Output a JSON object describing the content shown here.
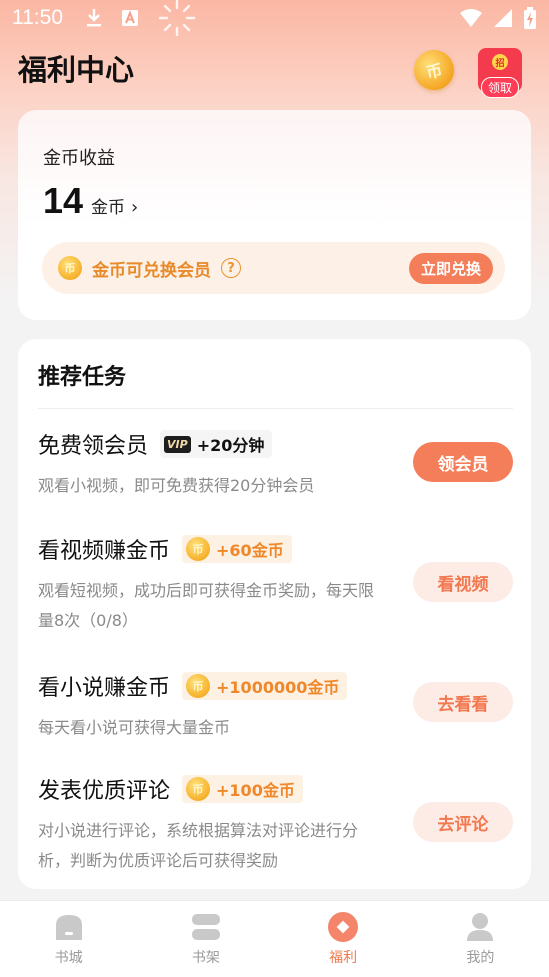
{
  "status_bar": {
    "time": "11:50",
    "left_icons": [
      "download-icon",
      "font-a-icon",
      "spinner-icon"
    ],
    "right_icons": [
      "wifi-icon",
      "signal-icon",
      "battery-charging-icon"
    ]
  },
  "header": {
    "title": "福利中心",
    "coin_glyph": "币",
    "redpack_badge": "招",
    "redpack_label": "领取"
  },
  "earnings": {
    "label": "金币收益",
    "value": "14",
    "unit": "金币",
    "chevron": "›",
    "coin_glyph": "币",
    "exchange_text": "金币可兑换会员",
    "help_glyph": "?",
    "exchange_button": "立即兑换"
  },
  "tasks": {
    "title": "推荐任务",
    "coin_glyph": "币",
    "items": [
      {
        "title": "免费领会员",
        "tag_type": "vip",
        "vip_badge": "VIP",
        "tag": "+20分钟",
        "desc": "观看小视频，即可免费获得20分钟会员",
        "button": "领会员",
        "button_style": "primary"
      },
      {
        "title": "看视频赚金币",
        "tag_type": "coin",
        "tag": "+60金币",
        "desc": "观看短视频，成功后即可获得金币奖励，每天限量8次（0/8）",
        "button": "看视频",
        "button_style": "secondary"
      },
      {
        "title": "看小说赚金币",
        "tag_type": "coin",
        "tag": "+1000000金币",
        "desc": "每天看小说可获得大量金币",
        "button": "去看看",
        "button_style": "secondary"
      },
      {
        "title": "发表优质评论",
        "tag_type": "coin",
        "tag": "+100金币",
        "desc": "对小说进行评论，系统根据算法对评论进行分析，判断为优质评论后可获得奖励",
        "button": "去评论",
        "button_style": "secondary"
      }
    ]
  },
  "tabbar": {
    "items": [
      {
        "label": "书城",
        "icon": "bookstore-icon",
        "active": false
      },
      {
        "label": "书架",
        "icon": "bookshelf-icon",
        "active": false
      },
      {
        "label": "福利",
        "icon": "welfare-icon",
        "active": true
      },
      {
        "label": "我的",
        "icon": "profile-icon",
        "active": false
      }
    ]
  },
  "colors": {
    "accent": "#f57e5a",
    "coin_text": "#f0882a",
    "tab_active": "#f2784f",
    "tab_inactive": "#9a9a9a"
  }
}
